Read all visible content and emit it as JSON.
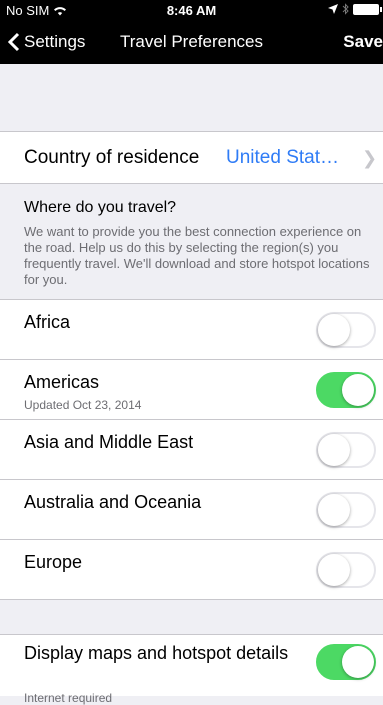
{
  "status_bar": {
    "carrier": "No SIM",
    "time": "8:46 AM",
    "icons": [
      "wifi-icon",
      "location-arrow-icon",
      "bluetooth-icon",
      "battery-icon"
    ]
  },
  "nav": {
    "back_label": "Settings",
    "title": "Travel Preferences",
    "save_label": "Save"
  },
  "country": {
    "label": "Country of residence",
    "value": "United Stat…"
  },
  "travel_section": {
    "heading": "Where do you travel?",
    "description": "We want to provide you the best connection experience on the road. Help us do this by selecting the region(s) you frequently travel. We'll download and store hotspot locations for you."
  },
  "regions": [
    {
      "label": "Africa",
      "sub": "",
      "on": false
    },
    {
      "label": "Americas",
      "sub": "Updated Oct 23, 2014",
      "on": true
    },
    {
      "label": "Asia and Middle East",
      "sub": "",
      "on": false
    },
    {
      "label": "Australia and Oceania",
      "sub": "",
      "on": false
    },
    {
      "label": "Europe",
      "sub": "",
      "on": false
    }
  ],
  "maps": {
    "label": "Display maps and hotspot details",
    "sub": "Internet required",
    "on": true
  },
  "colors": {
    "accent": "#2f7cf6",
    "switch_on": "#4cd964",
    "background": "#efeff4"
  }
}
